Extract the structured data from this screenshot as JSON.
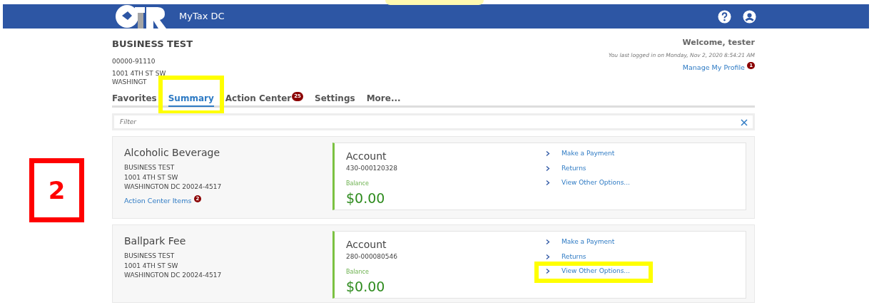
{
  "header": {
    "app_name": "MyTax DC"
  },
  "account_holder": {
    "name": "BUSINESS TEST",
    "id": "00000-91110",
    "address_lines": [
      "1001 4TH ST SW",
      "WASHINGT"
    ]
  },
  "welcome": {
    "greeting": "Welcome, tester",
    "last_login": "You last logged in on Monday, Nov 2, 2020 8:54:21 AM",
    "profile_link": "Manage My Profile",
    "profile_badge": "1"
  },
  "tabs": [
    {
      "label": "Favorites",
      "selected": false,
      "highlighted": false
    },
    {
      "label": "Summary",
      "selected": true,
      "highlighted": true
    },
    {
      "label": "Action Center",
      "selected": false,
      "highlighted": false,
      "badge": "25"
    },
    {
      "label": "Settings",
      "selected": false,
      "highlighted": false
    },
    {
      "label": "More...",
      "selected": false,
      "highlighted": false
    }
  ],
  "filter": {
    "placeholder": "Filter"
  },
  "accounts": [
    {
      "title": "Alcoholic Beverage",
      "owner": "BUSINESS TEST",
      "address_lines": [
        "1001 4TH ST SW",
        "WASHINGTON DC 20024-4517"
      ],
      "action_link": "Action Center Items",
      "action_badge": "2",
      "account_label": "Account",
      "account_number": "430-000120328",
      "balance_label": "Balance",
      "balance": "$0.00",
      "options": [
        {
          "label": "Make a Payment",
          "highlighted": false
        },
        {
          "label": "Returns",
          "highlighted": false
        },
        {
          "label": "View Other Options...",
          "highlighted": false
        }
      ]
    },
    {
      "title": "Ballpark Fee",
      "owner": "BUSINESS TEST",
      "address_lines": [
        "1001 4TH ST SW",
        "WASHINGTON DC 20024-4517"
      ],
      "account_label": "Account",
      "account_number": "280-000080546",
      "balance_label": "Balance",
      "balance": "$0.00",
      "options": [
        {
          "label": "Make a Payment",
          "highlighted": false
        },
        {
          "label": "Returns",
          "highlighted": false
        },
        {
          "label": "View Other Options...",
          "highlighted": true
        }
      ]
    }
  ],
  "annotations": {
    "step_number": "2"
  }
}
